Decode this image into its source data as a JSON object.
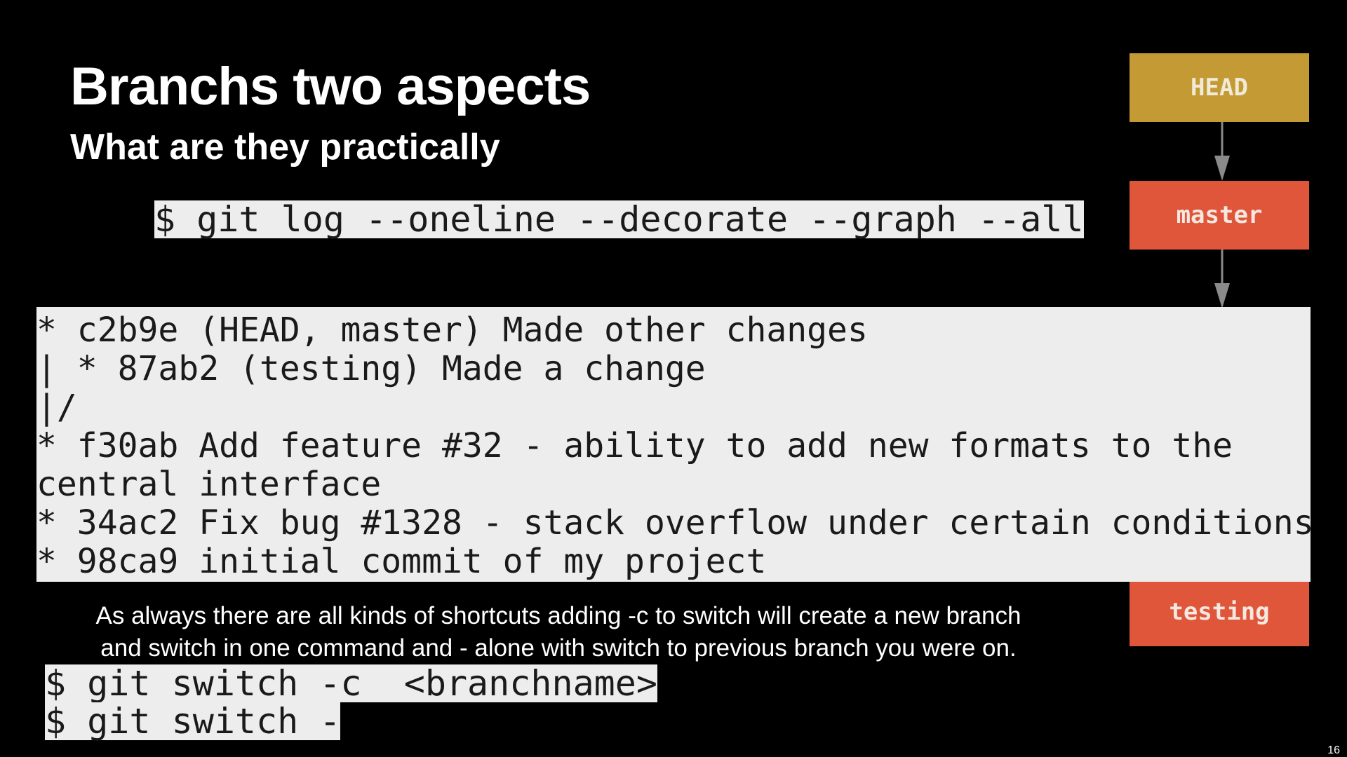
{
  "slide": {
    "title": "Branchs two aspects",
    "subtitle": "What are they practically",
    "command_top": "$ git log --oneline --decorate --graph --all",
    "log_lines": [
      "* c2b9e (HEAD, master) Made other changes",
      "| * 87ab2 (testing) Made a change",
      "|/",
      "* f30ab Add feature #32 - ability to add new formats to the",
      "central interface",
      "* 34ac2 Fix bug #1328 - stack overflow under certain conditions",
      "* 98ca9 initial commit of my project"
    ],
    "note_line1": "As always there are all kinds of shortcuts adding -c to switch will create a new branch",
    "note_line2": "and switch in one command and - alone with switch to previous branch you were on.",
    "command_switch_create": "$ git switch -c  <branchname>",
    "command_switch_prev": "$ git switch -",
    "page_number": "16"
  },
  "diagram": {
    "head_label": "HEAD",
    "master_label": "master",
    "testing_label": "testing",
    "head_color": "#c49a34",
    "branch_color": "#e0563a",
    "arrow_color": "#8a8a8a"
  }
}
